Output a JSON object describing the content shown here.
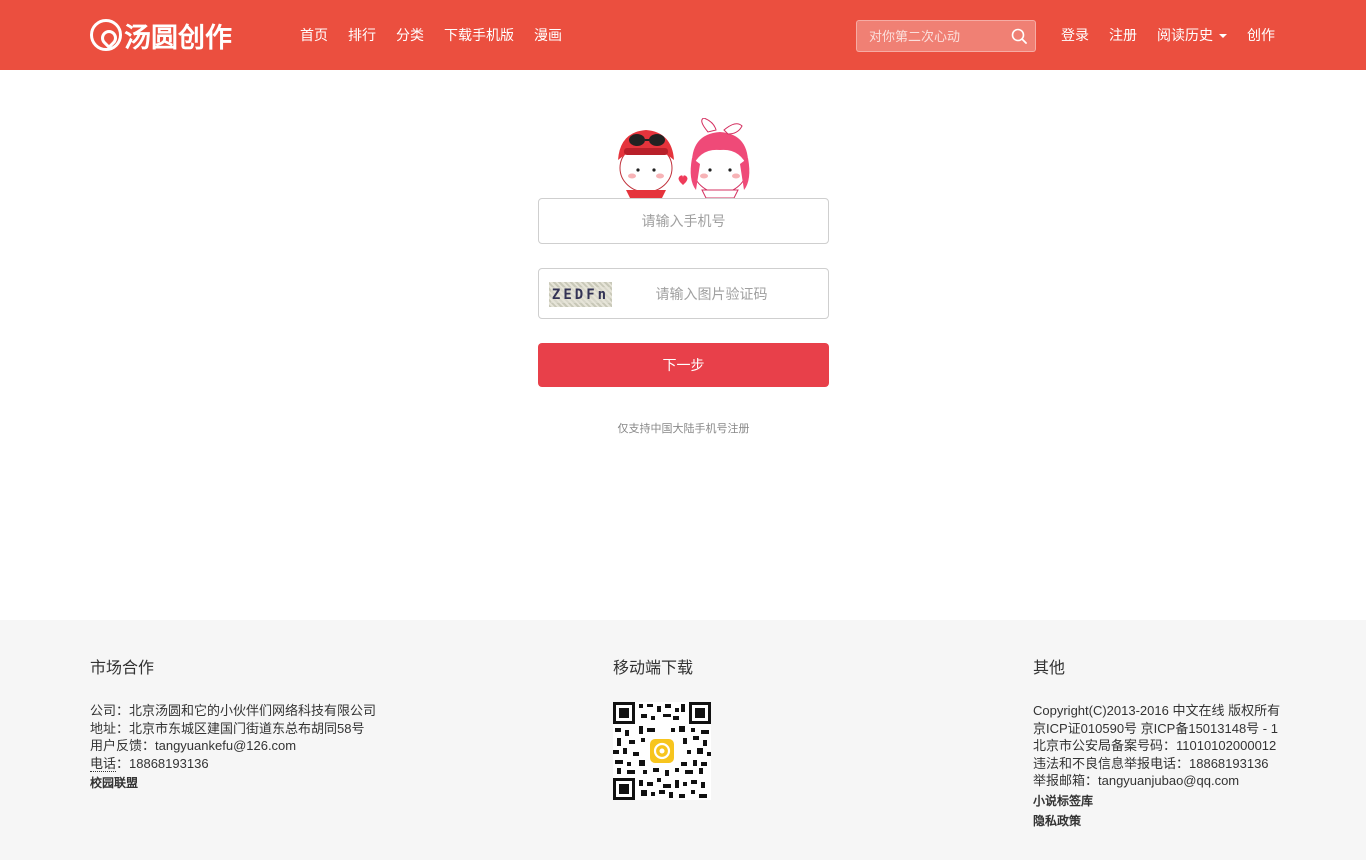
{
  "header": {
    "logo_text": "汤圆创作",
    "nav": [
      "首页",
      "排行",
      "分类",
      "下载手机版",
      "漫画"
    ],
    "search_placeholder": "对你第二次心动",
    "login": "登录",
    "register": "注册",
    "history": "阅读历史",
    "create": "创作",
    "brand_color": "#eb4f3f"
  },
  "form": {
    "phone_placeholder": "请输入手机号",
    "captcha_text": "ZEDFn",
    "captcha_placeholder": "请输入图片验证码",
    "next_label": "下一步",
    "note": "仅支持中国大陆手机号注册",
    "button_color": "#e8404a"
  },
  "footer": {
    "col1": {
      "title": "市场合作",
      "company": "公司：北京汤圆和它的小伙伴们网络科技有限公司",
      "address": "地址：北京市东城区建国门街道东总布胡同58号",
      "feedback": "用户反馈：tangyuankefu@126.com",
      "phone_label": "电话",
      "phone_value": "：18868193136",
      "link": "校园联盟"
    },
    "col2": {
      "title": "移动端下载"
    },
    "col3": {
      "title": "其他",
      "copyright": "Copyright(C)2013-2016 中文在线 版权所有",
      "icp": "京ICP证010590号 京ICP备15013148号 - 1",
      "police": "北京市公安局备案号码：11010102000012",
      "report_phone": "违法和不良信息举报电话：18868193136",
      "report_email": "举报邮箱：tangyuanjubao@qq.com",
      "link1": "小说标签库",
      "link2": "隐私政策"
    }
  }
}
